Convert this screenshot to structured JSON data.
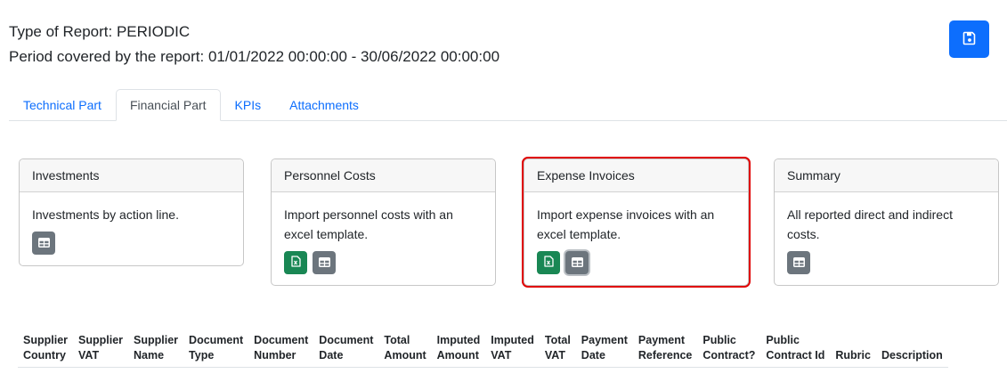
{
  "header": {
    "type_line": "Type of Report: PERIODIC",
    "period_line": "Period covered by the report: 01/01/2022 00:00:00 - 30/06/2022 00:00:00",
    "save_icon": "floppy-disk-icon",
    "accent_color": "#0d6efd"
  },
  "tabs": [
    {
      "label": "Technical Part",
      "active": false
    },
    {
      "label": "Financial Part",
      "active": true
    },
    {
      "label": "KPIs",
      "active": false
    },
    {
      "label": "Attachments",
      "active": false
    }
  ],
  "cards": [
    {
      "title": "Investments",
      "text": "Investments by action line.",
      "buttons": [
        "table-icon"
      ]
    },
    {
      "title": "Personnel Costs",
      "text": "Import personnel costs with an excel template.",
      "buttons": [
        "excel-file-icon",
        "table-icon"
      ]
    },
    {
      "title": "Expense Invoices",
      "text": "Import expense invoices with an excel template.",
      "buttons": [
        "excel-file-icon",
        "table-icon"
      ],
      "highlighted": true
    },
    {
      "title": "Summary",
      "text": "All reported direct and indirect costs.",
      "buttons": [
        "table-icon"
      ]
    }
  ],
  "table": {
    "columns": [
      [
        "Supplier",
        "Country"
      ],
      [
        "Supplier",
        "VAT"
      ],
      [
        "Supplier",
        "Name"
      ],
      [
        "Document",
        "Type"
      ],
      [
        "Document",
        "Number"
      ],
      [
        "Document",
        "Date"
      ],
      [
        "Total",
        "Amount"
      ],
      [
        "Imputed",
        "Amount"
      ],
      [
        "Imputed",
        "VAT"
      ],
      [
        "Total",
        "VAT"
      ],
      [
        "Payment",
        "Date"
      ],
      [
        "Payment",
        "Reference"
      ],
      [
        "Public",
        "Contract?"
      ],
      [
        "Public",
        "Contract Id"
      ],
      [
        "",
        "Rubric"
      ],
      [
        "",
        "Description"
      ]
    ]
  },
  "colors": {
    "excel_button": "#198754",
    "table_button": "#6c757d",
    "highlight_border": "#e00000"
  }
}
